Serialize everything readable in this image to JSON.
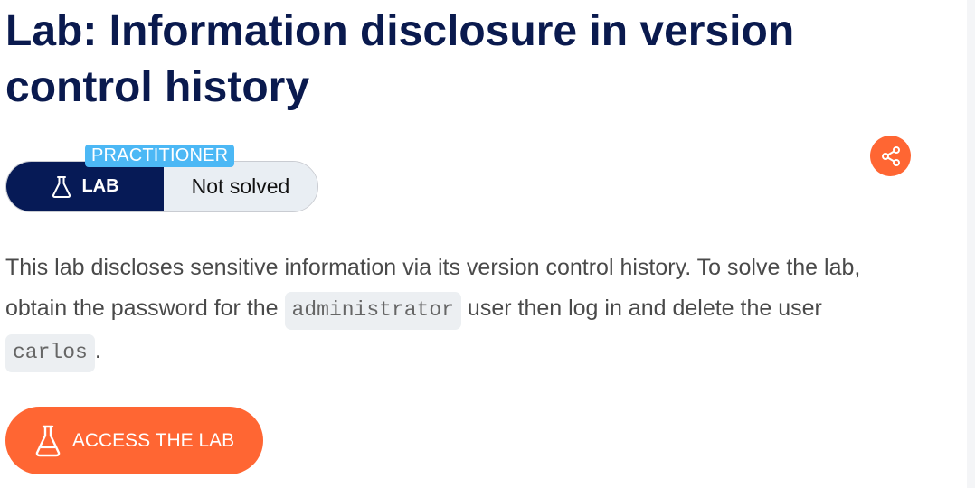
{
  "page": {
    "title": "Lab: Information disclosure in version control history"
  },
  "lab_meta": {
    "level": "PRACTITIONER",
    "type_label": "LAB",
    "status": "Not solved"
  },
  "description": {
    "part1": "This lab discloses sensitive information via its version control history. To solve the lab, obtain the password for the ",
    "code1": "administrator",
    "part2": " user then log in and delete the user ",
    "code2": "carlos",
    "part3": "."
  },
  "actions": {
    "access_label": "ACCESS THE LAB"
  },
  "icons": {
    "lab": "flask-icon",
    "share": "share-icon"
  },
  "colors": {
    "title": "#0a1a4e",
    "lab_pill_dark": "#061a56",
    "status_bg": "#e9eef3",
    "level_badge": "#4cb8f5",
    "accent": "#ff6633"
  }
}
